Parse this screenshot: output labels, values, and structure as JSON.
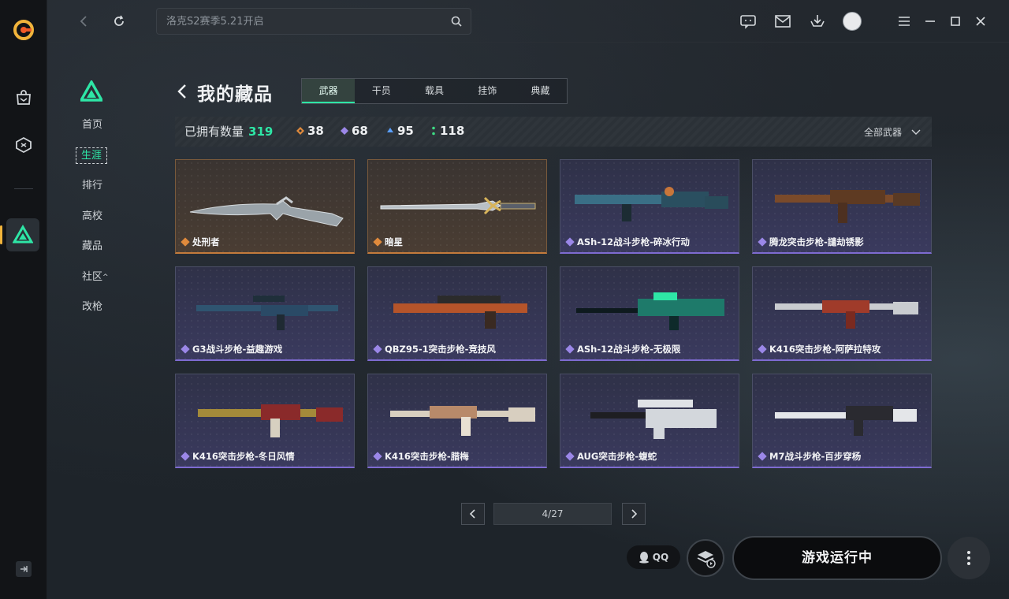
{
  "search": {
    "placeholder": "洛克S2赛季5.21开启"
  },
  "subnav": {
    "items": [
      {
        "label": "首页"
      },
      {
        "label": "生涯"
      },
      {
        "label": "排行"
      },
      {
        "label": "高校"
      },
      {
        "label": "藏品"
      },
      {
        "label": "社区"
      },
      {
        "label": "改枪"
      }
    ],
    "active_index": 1
  },
  "page": {
    "title": "我的藏品",
    "tabs": [
      {
        "label": "武器"
      },
      {
        "label": "干员"
      },
      {
        "label": "载具"
      },
      {
        "label": "挂饰"
      },
      {
        "label": "典藏"
      }
    ],
    "active_tab": 0
  },
  "stats": {
    "owned_label": "已拥有数量",
    "owned_count": "319",
    "orange": "38",
    "purple": "68",
    "blue": "95",
    "green": "118",
    "filter_label": "全部武器"
  },
  "items": [
    {
      "name": "处刑者",
      "rarity": "orange"
    },
    {
      "name": "暗星",
      "rarity": "orange"
    },
    {
      "name": "ASh-12战斗步枪-碎冰行动",
      "rarity": "purple"
    },
    {
      "name": "腾龙突击步枪-譴劫锈影",
      "rarity": "purple"
    },
    {
      "name": "G3战斗步枪-益趣游戏",
      "rarity": "purple"
    },
    {
      "name": "QBZ95-1突击步枪-竞技风",
      "rarity": "purple"
    },
    {
      "name": "ASh-12战斗步枪-无极限",
      "rarity": "purple"
    },
    {
      "name": "K416突击步枪-阿萨拉特攻",
      "rarity": "purple"
    },
    {
      "name": "K416突击步枪-冬日风情",
      "rarity": "purple"
    },
    {
      "name": "K416突击步枪-腊梅",
      "rarity": "purple"
    },
    {
      "name": "AUG突击步枪-蝮蛇",
      "rarity": "purple"
    },
    {
      "name": "M7战斗步枪-百步穿杨",
      "rarity": "purple"
    }
  ],
  "pagination": {
    "current": "4/27"
  },
  "footer": {
    "qq_label": "QQ",
    "run_label": "游戏运行中"
  },
  "colors": {
    "accent": "#2ee6a6",
    "orange_rarity": "#e08a3c",
    "purple_rarity": "#9b87e8",
    "blue_rarity": "#5aa0ff",
    "green_rarity": "#3ddc84"
  },
  "icons": {
    "app_logo": "app-logo-icon",
    "shop": "shop-bag-icon",
    "games": "game-box-icon",
    "delta": "delta-force-icon",
    "search": "search-icon",
    "chat": "chat-icon",
    "mail": "mail-icon",
    "download": "download-icon"
  }
}
